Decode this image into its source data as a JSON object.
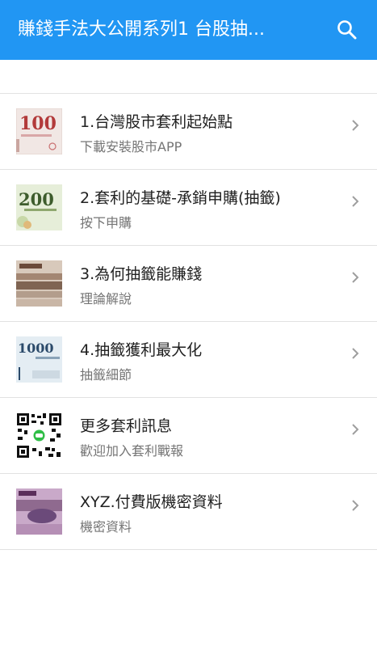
{
  "appbar": {
    "title": "賺錢手法大公開系列1 台股抽...",
    "search_icon": "search-icon",
    "color": "#2196F3"
  },
  "list": {
    "items": [
      {
        "title": "1.台灣股市套利起始點",
        "subtitle": "下載安裝股市APP",
        "thumb_icon": "banknote-100-icon",
        "thumb_text": "100"
      },
      {
        "title": "2.套利的基礎-承銷申購(抽籤)",
        "subtitle": "按下申購",
        "thumb_icon": "banknote-200-icon",
        "thumb_text": "200"
      },
      {
        "title": "3.為何抽籤能賺錢",
        "subtitle": "理論解說",
        "thumb_icon": "banknote-500-icon"
      },
      {
        "title": "4.抽籤獲利最大化",
        "subtitle": "抽籤細節",
        "thumb_icon": "banknote-1000-icon",
        "thumb_text": "1000"
      },
      {
        "title": "更多套利訊息",
        "subtitle": "歡迎加入套利戰報",
        "thumb_icon": "qr-code-icon"
      },
      {
        "title": "XYZ.付費版機密資料",
        "subtitle": "機密資料",
        "thumb_icon": "banknote-2000-icon"
      }
    ],
    "chevron_icon": "chevron-right-icon"
  }
}
